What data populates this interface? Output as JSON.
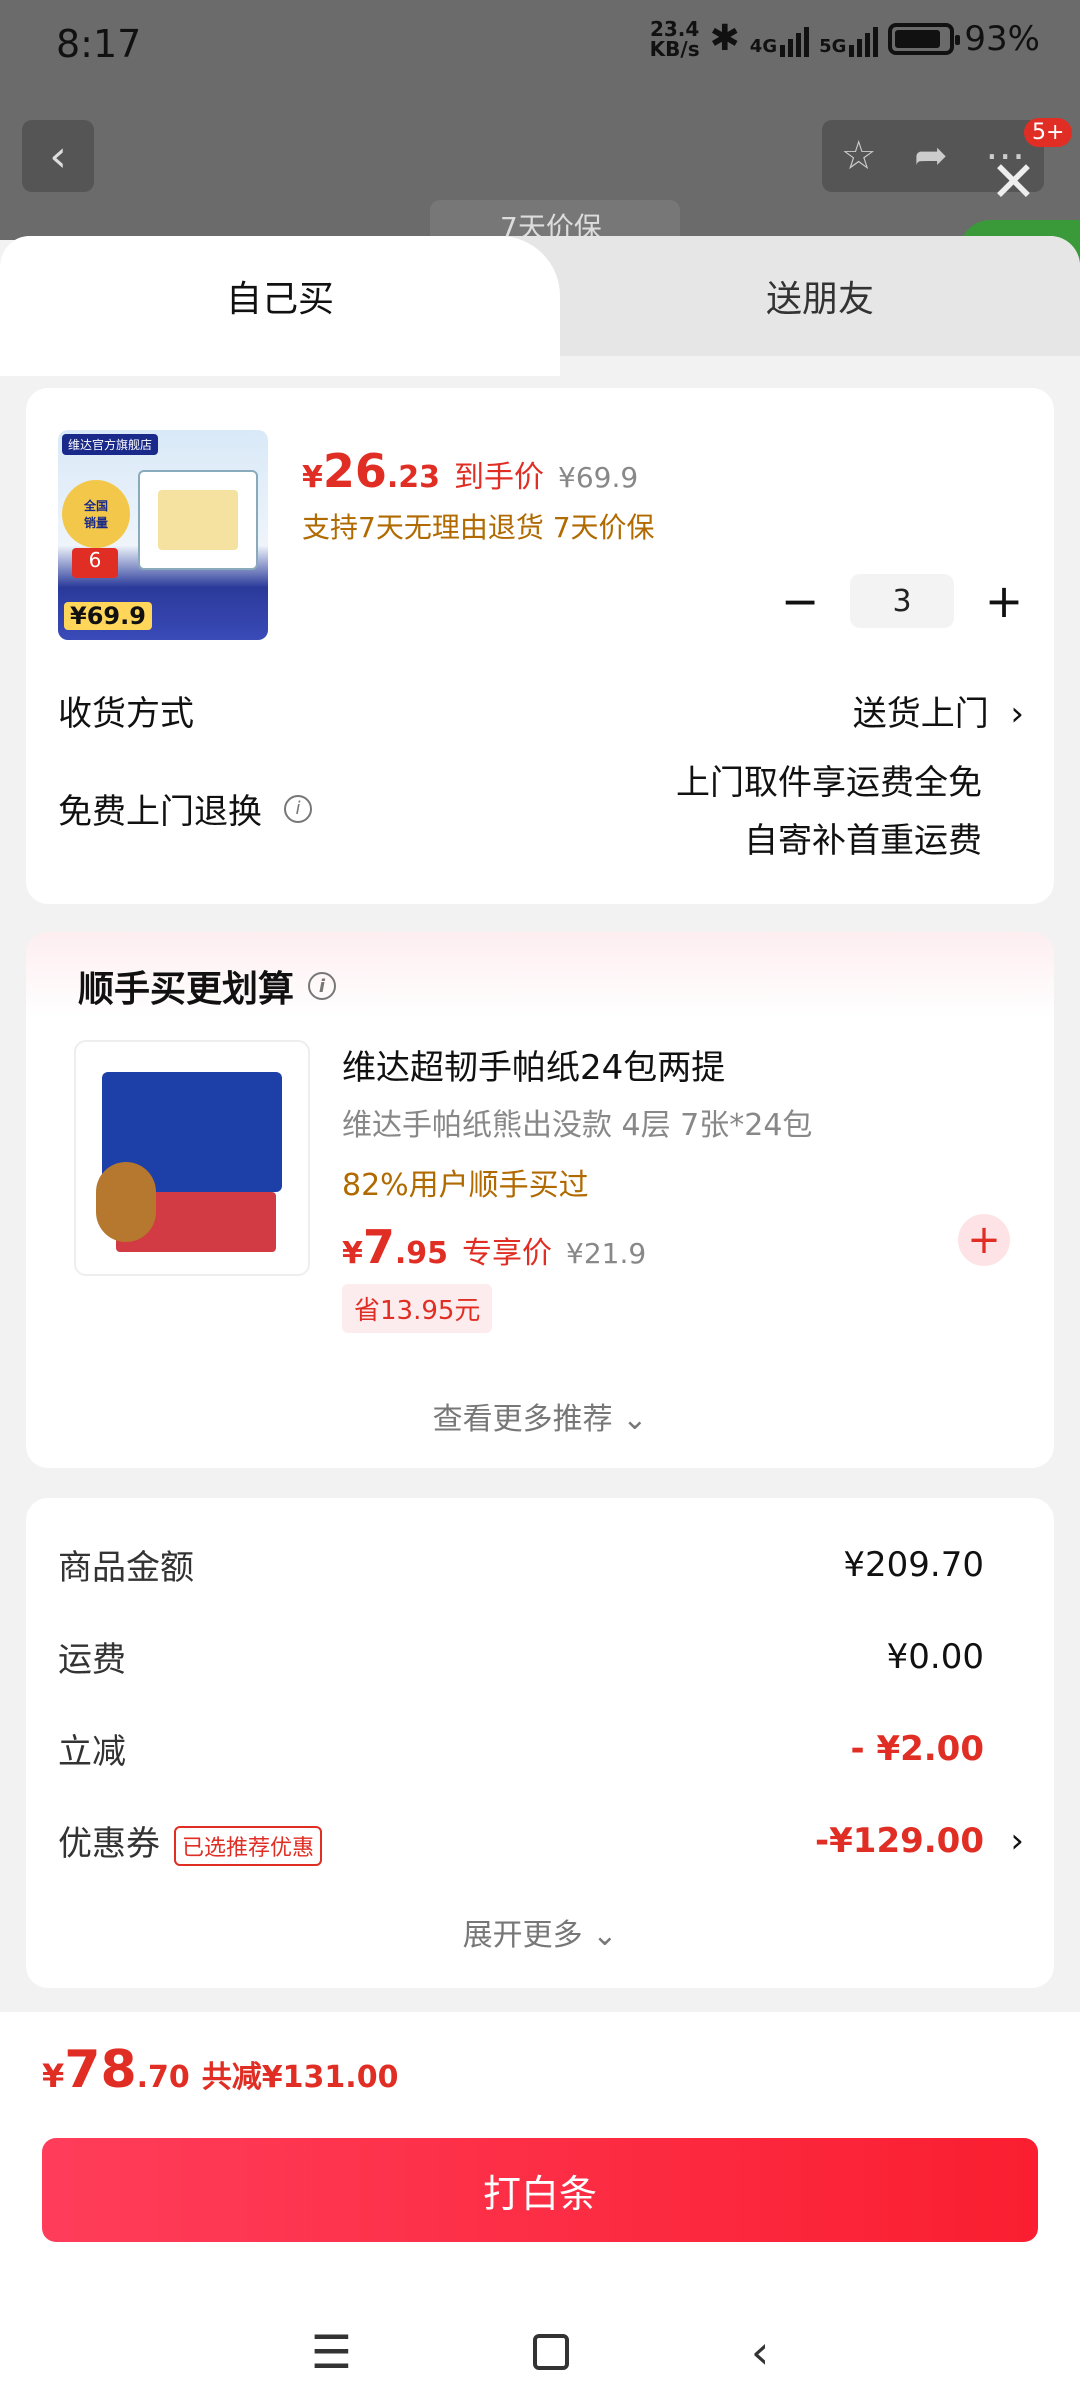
{
  "status": {
    "time": "8:17",
    "net_speed_top": "23.4",
    "net_speed_bottom": "KB/s",
    "network1": "4G",
    "network2": "5G",
    "battery_pct": "93%"
  },
  "backdrop": {
    "peek_text": "7天价保",
    "badge": "5+"
  },
  "tabs": {
    "self": "自己买",
    "friend": "送朋友"
  },
  "product": {
    "image_store_label": "维达官方旗舰店",
    "image_price": "¥69.9",
    "price_symbol": "¥",
    "price_int": "26",
    "price_dec": ".23",
    "price_tag": "到手价",
    "price_original": "¥69.9",
    "promise": "支持7天无理由退货 7天价保",
    "quantity": "3",
    "minus": "−",
    "plus": "+"
  },
  "delivery": {
    "label": "收货方式",
    "value": "送货上门"
  },
  "returns": {
    "label": "免费上门退换",
    "line1": "上门取件享运费全免",
    "line2": "自寄补首重运费"
  },
  "recommend": {
    "title": "顺手买更划算",
    "name": "维达超韧手帕纸24包两提",
    "subtitle": "维达手帕纸熊出没款 4层 7张*24包",
    "rate": "82%用户顺手买过",
    "price_symbol": "¥",
    "price_int": "7",
    "price_dec": ".95",
    "price_tag": "专享价",
    "price_original": "¥21.9",
    "save": "省13.95元",
    "more": "查看更多推荐 ⌄"
  },
  "summary": {
    "rows": [
      {
        "label": "商品金额",
        "value": "¥209.70"
      },
      {
        "label": "运费",
        "value": "¥0.00"
      },
      {
        "label": "立减",
        "value": "- ¥2.00"
      },
      {
        "label": "优惠券",
        "value": "-¥129.00",
        "badge": "已选推荐优惠"
      }
    ],
    "expand": "展开更多 ⌄"
  },
  "footer": {
    "total_symbol": "¥",
    "total_int": "78",
    "total_dec": ".70",
    "total_reduce": "共减¥131.00",
    "pay_button": "打白条"
  },
  "colors": {
    "accent": "#e02e24",
    "pay_button": "#fa1e30"
  }
}
